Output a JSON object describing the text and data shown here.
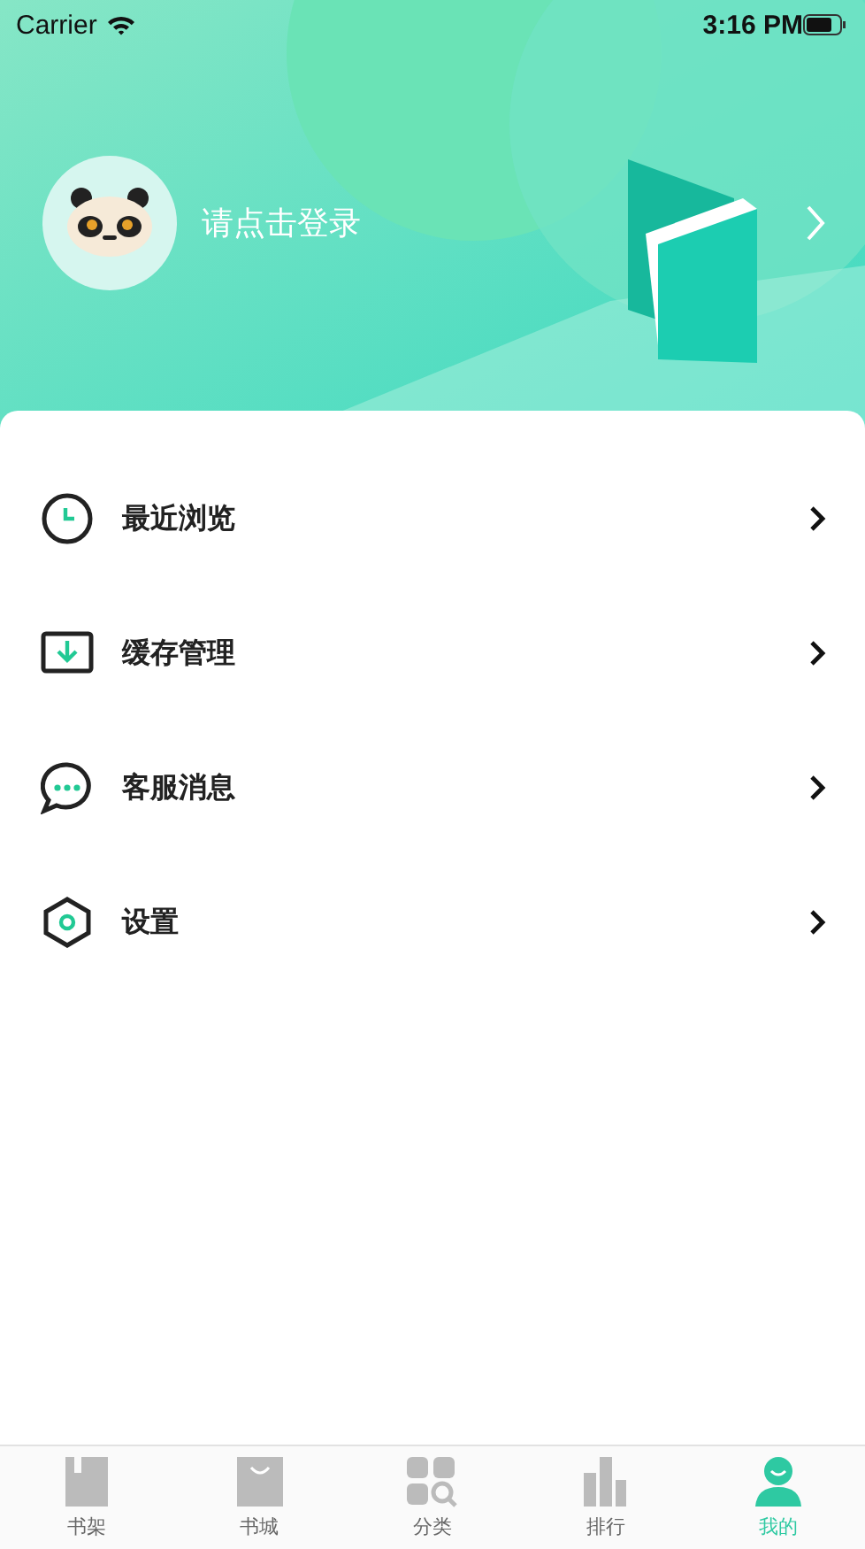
{
  "status_bar": {
    "carrier": "Carrier",
    "time": "3:16 PM"
  },
  "profile": {
    "login_prompt": "请点击登录"
  },
  "menu": [
    {
      "kind": "recent",
      "label": "最近浏览"
    },
    {
      "kind": "cache",
      "label": "缓存管理"
    },
    {
      "kind": "messages",
      "label": "客服消息"
    },
    {
      "kind": "settings",
      "label": "设置"
    }
  ],
  "tabs": [
    {
      "kind": "shelf",
      "label": "书架",
      "selected": false
    },
    {
      "kind": "store",
      "label": "书城",
      "selected": false
    },
    {
      "kind": "category",
      "label": "分类",
      "selected": false
    },
    {
      "kind": "ranking",
      "label": "排行",
      "selected": false
    },
    {
      "kind": "mine",
      "label": "我的",
      "selected": true
    }
  ]
}
